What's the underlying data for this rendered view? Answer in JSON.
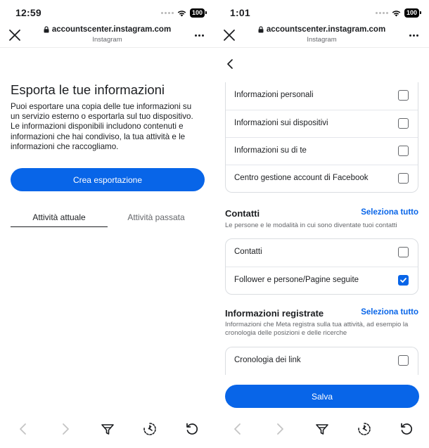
{
  "left": {
    "status_time": "12:59",
    "battery": "100",
    "url": "accountscenter.instagram.com",
    "url_sub": "Instagram",
    "title": "Esporta le tue informazioni",
    "description": "Puoi esportare una copia delle tue informazioni su un servizio esterno o esportarla sul tuo dispositivo. Le informazioni disponibili includono contenuti e informazioni che hai condiviso, la tua attività e le informazioni che raccogliamo.",
    "create_button": "Crea esportazione",
    "tabs": [
      {
        "label": "Attività attuale",
        "active": true
      },
      {
        "label": "Attività passata",
        "active": false
      }
    ]
  },
  "right": {
    "status_time": "1:01",
    "battery": "100",
    "url": "accountscenter.instagram.com",
    "url_sub": "Instagram",
    "card1": [
      {
        "label": "Informazioni personali",
        "checked": false
      },
      {
        "label": "Informazioni sui dispositivi",
        "checked": false
      },
      {
        "label": "Informazioni su di te",
        "checked": false
      },
      {
        "label": "Centro gestione account di Facebook",
        "checked": false
      }
    ],
    "contacts": {
      "title": "Contatti",
      "select_all": "Seleziona tutto",
      "description": "Le persone e le modalità in cui sono diventate tuoi contatti",
      "items": [
        {
          "label": "Contatti",
          "checked": false
        },
        {
          "label": "Follower e persone/Pagine seguite",
          "checked": true
        }
      ]
    },
    "logged": {
      "title": "Informazioni registrate",
      "select_all": "Seleziona tutto",
      "description": "Informazioni che Meta registra sulla tua attività, ad esempio la cronologia delle posizioni e delle ricerche",
      "items": [
        {
          "label": "Cronologia dei link",
          "checked": false
        }
      ]
    },
    "save_button": "Salva"
  },
  "colors": {
    "accent": "#0865e8",
    "text": "#1c1e21",
    "secondary_text": "#65676b",
    "border": "#dadde1"
  },
  "icons": [
    "close-icon",
    "lock-icon",
    "more-icon",
    "back-arrow-icon",
    "chevron-left-icon",
    "chevron-right-icon",
    "filter-icon",
    "history-icon",
    "refresh-icon",
    "checkmark-icon",
    "wifi-icon",
    "battery-icon"
  ]
}
